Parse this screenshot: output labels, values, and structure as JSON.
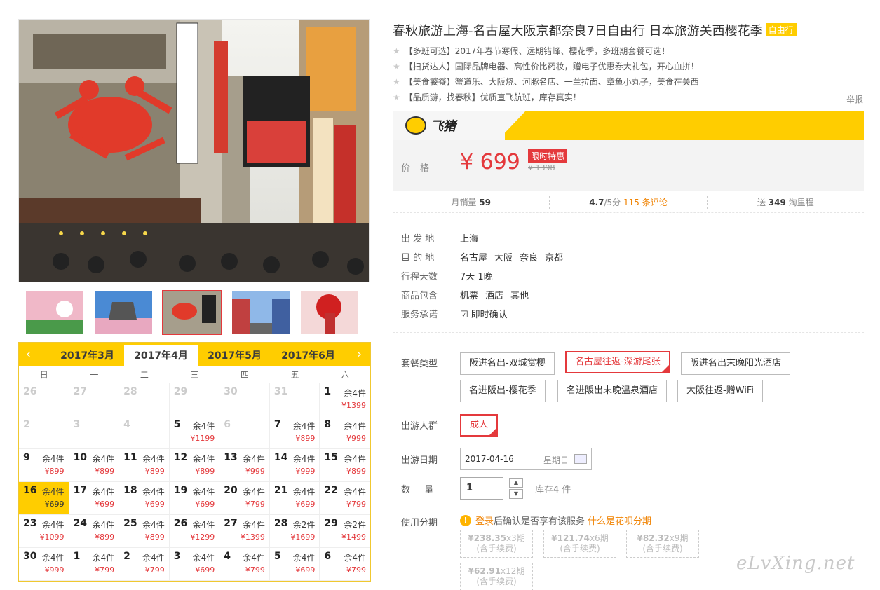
{
  "product": {
    "title": "春秋旅游上海-名古屋大阪京都奈良7日自由行 日本旅游关西樱花季",
    "type_tag": "自由行",
    "features": [
      "【多班可选】2017年春节寒假、远期错峰、樱花季，多班期套餐可选！",
      "【扫货达人】国际品牌电器、高性价比药妆，赠电子优惠券大礼包，开心血拼！",
      "【美食饕餮】蟹道乐、大阪烧、河豚名店、一兰拉面、章鱼小丸子，美食在关西",
      "【品质游，找春秋】优质直飞航班，库存真实！"
    ],
    "report": "举报"
  },
  "brand": {
    "name": "飞猪"
  },
  "price": {
    "label": "价格",
    "current": "¥ 699",
    "badge": "限时特惠",
    "original": "¥ 1398"
  },
  "stats": {
    "monthly_sales_label": "月销量",
    "monthly_sales": "59",
    "rating": "4.7",
    "rating_suffix": "/5分",
    "reviews": "115 条评论",
    "points_prefix": "送",
    "points": "349",
    "points_suffix": "淘里程"
  },
  "info": [
    {
      "k": "出 发 地",
      "v": [
        "上海"
      ]
    },
    {
      "k": "目 的 地",
      "v": [
        "名古屋",
        "大阪",
        "奈良",
        "京都"
      ]
    },
    {
      "k": "行程天数",
      "v": [
        "7天 1晚"
      ]
    },
    {
      "k": "商品包含",
      "v": [
        "机票",
        "酒店",
        "其他"
      ]
    },
    {
      "k": "服务承诺",
      "v": [
        "即时确认"
      ]
    }
  ],
  "packages": {
    "label": "套餐类型",
    "options": [
      "阪进名出-双城赏樱",
      "名古屋往返-深游尾张",
      "阪进名出末晚阳光酒店",
      "名进阪出-樱花季",
      "名进阪出末晚温泉酒店",
      "大阪往返-赠WiFi"
    ],
    "selected_index": 1
  },
  "travelers": {
    "label": "出游人群",
    "value": "成人"
  },
  "travel_date": {
    "label": "出游日期",
    "value": "2017-04-16",
    "weekday": "星期日"
  },
  "quantity": {
    "label": "数 量",
    "value": "1",
    "stock": "库存4 件",
    "up": "▲",
    "down": "▼"
  },
  "installment": {
    "label": "使用分期",
    "login": "登录",
    "note": "后确认是否享有该服务",
    "link": "什么是花呗分期",
    "options": [
      {
        "amount": "¥238.35",
        "periods": "x3期",
        "fee": "(含手续费)"
      },
      {
        "amount": "¥121.74",
        "periods": "x6期",
        "fee": "(含手续费)"
      },
      {
        "amount": "¥82.32",
        "periods": "x9期",
        "fee": "(含手续费)"
      },
      {
        "amount": "¥62.91",
        "periods": "x12期",
        "fee": "(含手续费)"
      }
    ]
  },
  "calendar": {
    "months": [
      "2017年3月",
      "2017年4月",
      "2017年5月",
      "2017年6月"
    ],
    "active_month": 1,
    "prev": "‹",
    "next": "›",
    "weekdays": [
      "日",
      "一",
      "二",
      "三",
      "四",
      "五",
      "六"
    ],
    "cells": [
      {
        "d": "26",
        "past": true
      },
      {
        "d": "27",
        "past": true
      },
      {
        "d": "28",
        "past": true
      },
      {
        "d": "29",
        "past": true
      },
      {
        "d": "30",
        "past": true
      },
      {
        "d": "31",
        "past": true
      },
      {
        "d": "1",
        "rem": "余4件",
        "pr": "¥1399"
      },
      {
        "d": "2",
        "past": true
      },
      {
        "d": "3",
        "past": true
      },
      {
        "d": "4",
        "past": true
      },
      {
        "d": "5",
        "rem": "余4件",
        "pr": "¥1199"
      },
      {
        "d": "6",
        "past": true
      },
      {
        "d": "7",
        "rem": "余4件",
        "pr": "¥899"
      },
      {
        "d": "8",
        "rem": "余4件",
        "pr": "¥999"
      },
      {
        "d": "9",
        "rem": "余4件",
        "pr": "¥899"
      },
      {
        "d": "10",
        "rem": "余4件",
        "pr": "¥899"
      },
      {
        "d": "11",
        "rem": "余4件",
        "pr": "¥899"
      },
      {
        "d": "12",
        "rem": "余4件",
        "pr": "¥899"
      },
      {
        "d": "13",
        "rem": "余4件",
        "pr": "¥999"
      },
      {
        "d": "14",
        "rem": "余4件",
        "pr": "¥999"
      },
      {
        "d": "15",
        "rem": "余4件",
        "pr": "¥899"
      },
      {
        "d": "16",
        "rem": "余4件",
        "pr": "¥699",
        "sel": true
      },
      {
        "d": "17",
        "rem": "余4件",
        "pr": "¥699"
      },
      {
        "d": "18",
        "rem": "余4件",
        "pr": "¥699"
      },
      {
        "d": "19",
        "rem": "余4件",
        "pr": "¥699"
      },
      {
        "d": "20",
        "rem": "余4件",
        "pr": "¥799"
      },
      {
        "d": "21",
        "rem": "余4件",
        "pr": "¥699"
      },
      {
        "d": "22",
        "rem": "余4件",
        "pr": "¥799"
      },
      {
        "d": "23",
        "rem": "余4件",
        "pr": "¥1099"
      },
      {
        "d": "24",
        "rem": "余4件",
        "pr": "¥899"
      },
      {
        "d": "25",
        "rem": "余4件",
        "pr": "¥899"
      },
      {
        "d": "26",
        "rem": "余4件",
        "pr": "¥1299"
      },
      {
        "d": "27",
        "rem": "余4件",
        "pr": "¥1399"
      },
      {
        "d": "28",
        "rem": "余2件",
        "pr": "¥1699"
      },
      {
        "d": "29",
        "rem": "余2件",
        "pr": "¥1499"
      },
      {
        "d": "30",
        "rem": "余4件",
        "pr": "¥999"
      },
      {
        "d": "1",
        "rem": "余4件",
        "pr": "¥799"
      },
      {
        "d": "2",
        "rem": "余4件",
        "pr": "¥799"
      },
      {
        "d": "3",
        "rem": "余4件",
        "pr": "¥699"
      },
      {
        "d": "4",
        "rem": "余4件",
        "pr": "¥799"
      },
      {
        "d": "5",
        "rem": "余4件",
        "pr": "¥699"
      },
      {
        "d": "6",
        "rem": "余4件",
        "pr": "¥799"
      }
    ]
  },
  "watermark": "eLvXing.net",
  "colors": {
    "accent": "#ffcd00",
    "price": "#e4393c",
    "link": "#f08200"
  }
}
